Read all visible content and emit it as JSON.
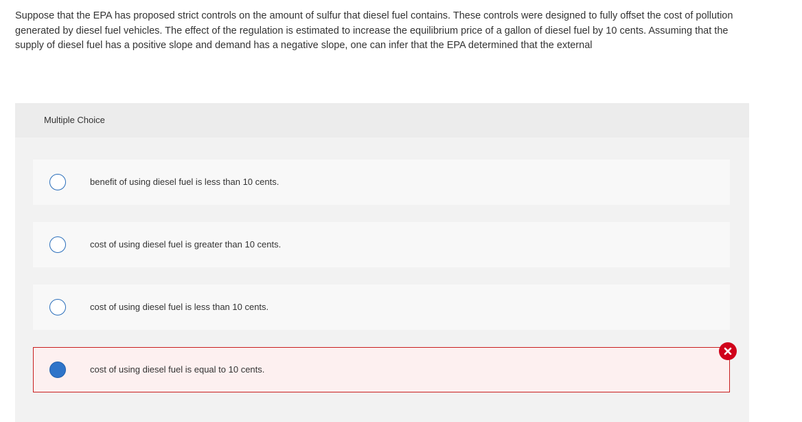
{
  "question": {
    "text": "Suppose that the EPA has proposed strict controls on the amount of sulfur that diesel fuel contains. These controls were designed to fully offset the cost of pollution generated by diesel fuel vehicles. The effect of the regulation is estimated to increase the equilibrium price of a gallon of diesel fuel by 10 cents. Assuming that the supply of diesel fuel has a positive slope and demand has a negative slope, one can infer that the EPA determined that the external"
  },
  "multiple_choice": {
    "header_label": "Multiple Choice",
    "options": [
      {
        "label": "benefit of using diesel fuel is less than 10 cents.",
        "selected": false
      },
      {
        "label": "cost of using diesel fuel is greater than 10 cents.",
        "selected": false
      },
      {
        "label": "cost of using diesel fuel is less than 10 cents.",
        "selected": false
      },
      {
        "label": "cost of using diesel fuel is equal to 10 cents.",
        "selected": true,
        "status": "incorrect"
      }
    ]
  },
  "colors": {
    "radio_border": "#2a6ebb",
    "radio_filled": "#2e74c9",
    "incorrect_border": "#c81e1e",
    "incorrect_background": "#fdf0f0",
    "incorrect_badge": "#d0021b"
  },
  "icons": {
    "incorrect_badge": "close-x-icon"
  }
}
